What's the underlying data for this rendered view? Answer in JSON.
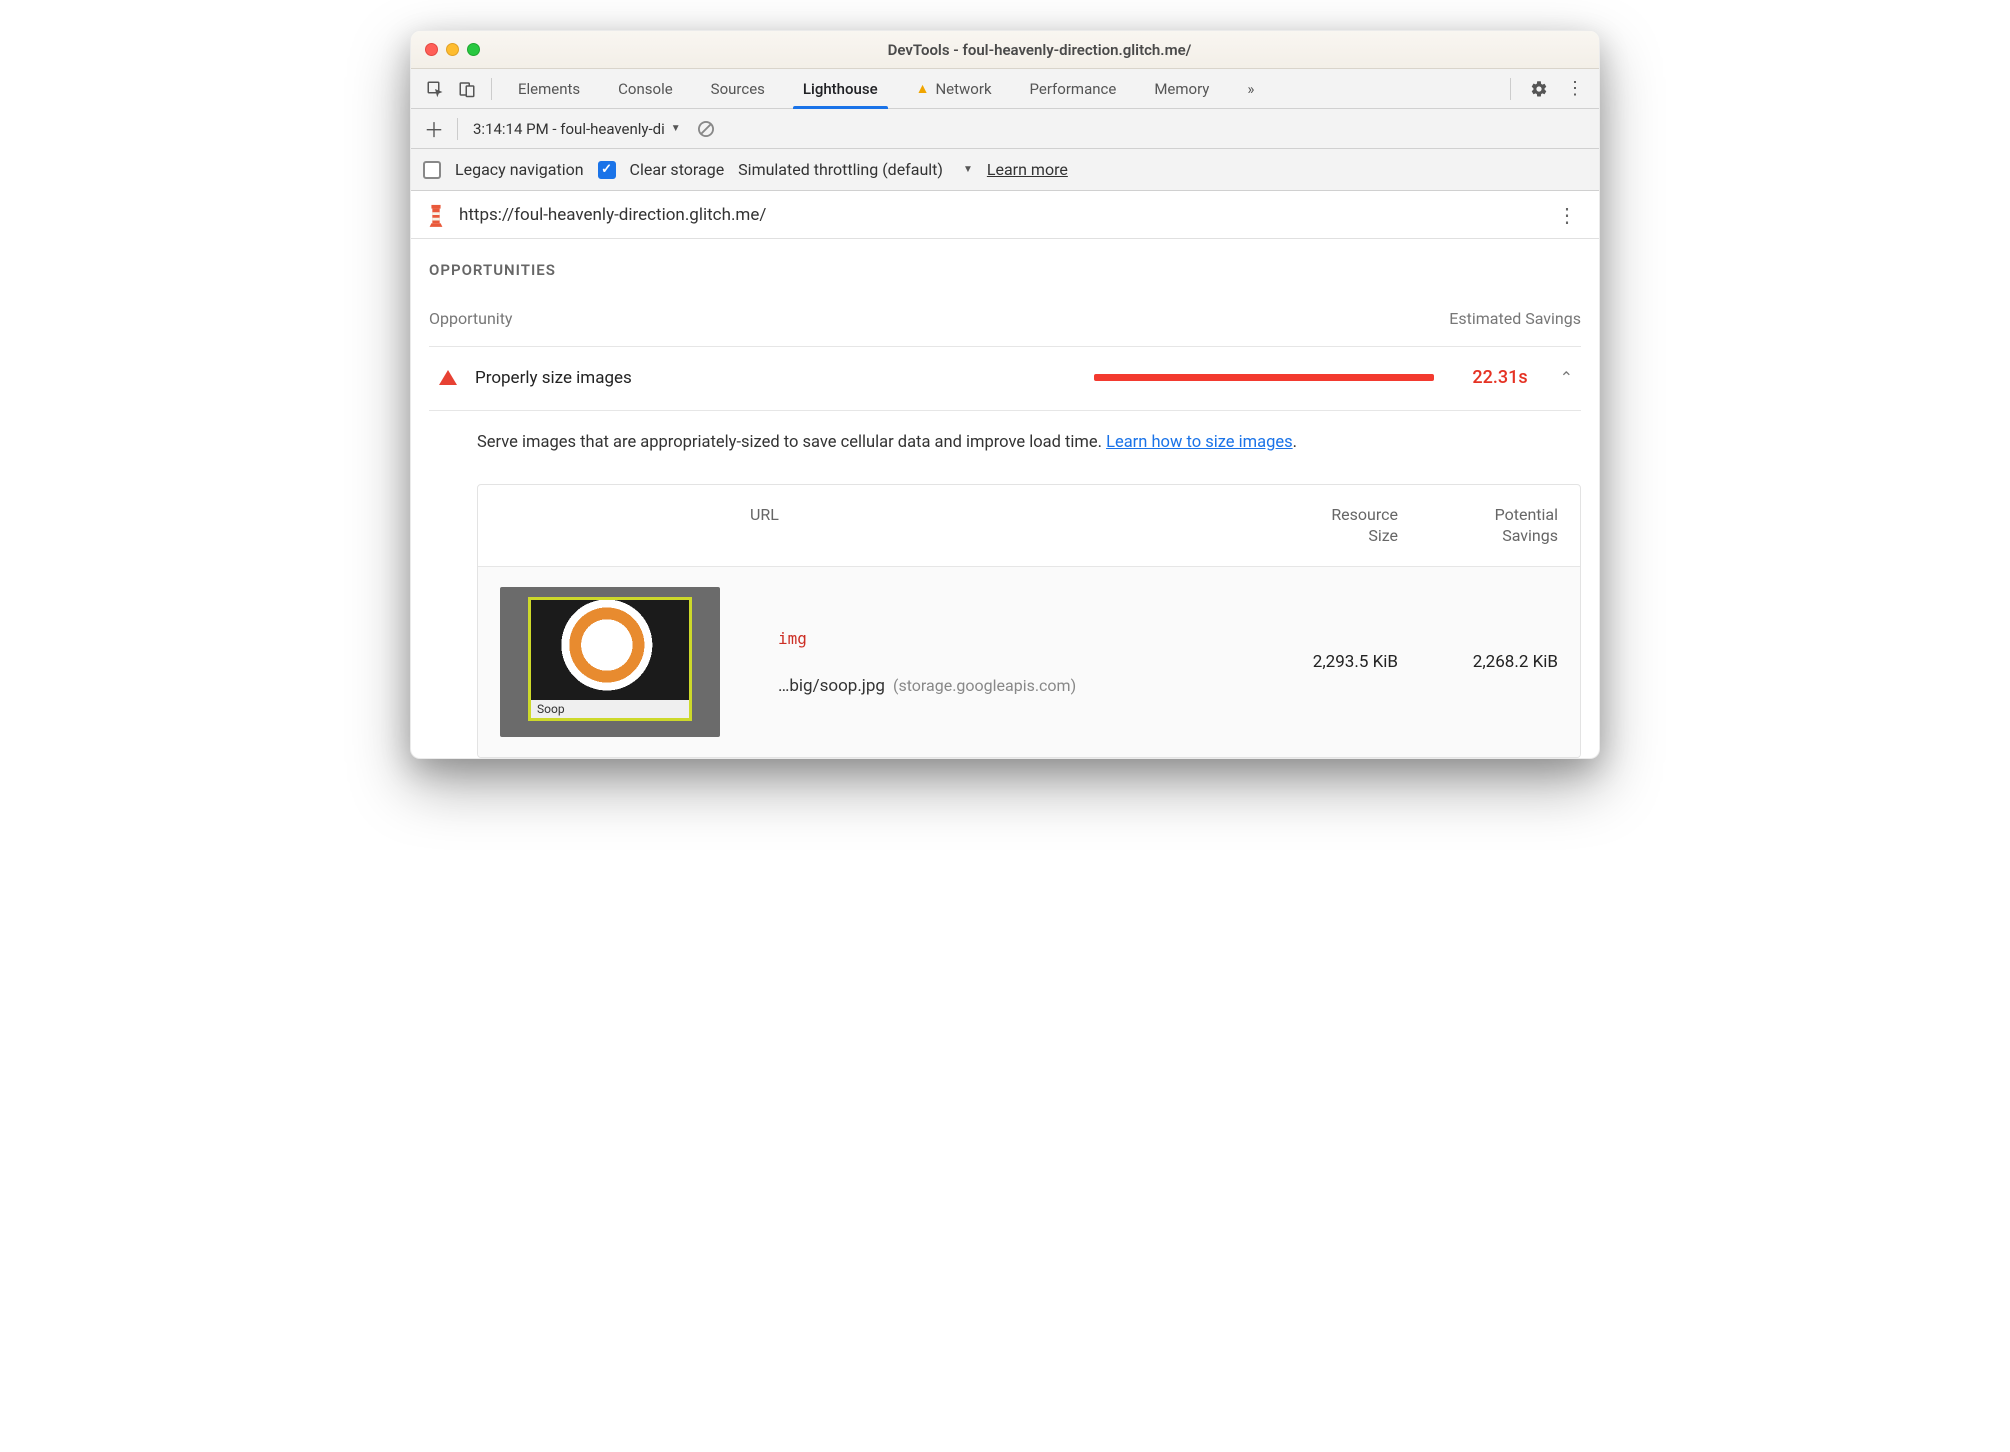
{
  "window": {
    "title": "DevTools - foul-heavenly-direction.glitch.me/"
  },
  "tabs": {
    "items": [
      "Elements",
      "Console",
      "Sources",
      "Lighthouse",
      "Network",
      "Performance",
      "Memory"
    ],
    "active": "Lighthouse",
    "warnTab": "Network",
    "more": "»"
  },
  "actionrow": {
    "timestamp": "3:14:14 PM - foul-heavenly-di"
  },
  "options": {
    "legacy": {
      "label": "Legacy navigation",
      "checked": false
    },
    "clear": {
      "label": "Clear storage",
      "checked": true
    },
    "throttling": "Simulated throttling (default)",
    "learn": "Learn more"
  },
  "urlbar": {
    "url": "https://foul-heavenly-direction.glitch.me/"
  },
  "section": {
    "title": "OPPORTUNITIES"
  },
  "columns": {
    "opp": "Opportunity",
    "sav": "Estimated Savings"
  },
  "item": {
    "name": "Properly size images",
    "savings": "22.31s",
    "description": "Serve images that are appropriately-sized to save cellular data and improve load time. ",
    "learnlink": "Learn how to size images"
  },
  "table": {
    "head": {
      "url": "URL",
      "size": "Resource Size",
      "savings": "Potential Savings"
    },
    "row": {
      "tag": "img",
      "path": "…big/soop.jpg",
      "host": "(storage.googleapis.com)",
      "size": "2,293.5 KiB",
      "savings": "2,268.2 KiB",
      "caption": "Soop"
    }
  }
}
